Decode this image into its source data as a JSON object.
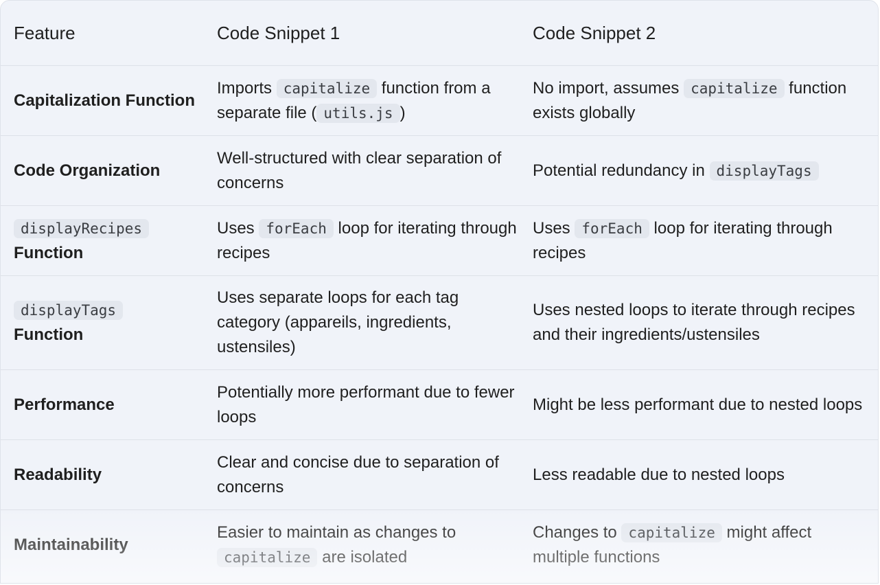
{
  "table": {
    "headers": [
      "Feature",
      "Code Snippet 1",
      "Code Snippet 2"
    ],
    "rows": [
      {
        "feature": {
          "name": "Capitalization Function"
        },
        "snippet1": {
          "t1": "Imports ",
          "c1": "capitalize",
          "t2": " function from a separate file (",
          "c2": "utils.js",
          "t3": ")"
        },
        "snippet2": {
          "t1": "No import, assumes ",
          "c1": "capitalize",
          "t2": " function exists globally"
        }
      },
      {
        "feature": {
          "name": "Code Organization"
        },
        "snippet1": {
          "t1": "Well-structured with clear separation of concerns"
        },
        "snippet2": {
          "t1": "Potential redundancy in ",
          "c1": "displayTags"
        }
      },
      {
        "feature": {
          "code": "displayRecipes",
          "name": "Function"
        },
        "snippet1": {
          "t1": "Uses ",
          "c1": "forEach",
          "t2": " loop for iterating through recipes"
        },
        "snippet2": {
          "t1": "Uses ",
          "c1": "forEach",
          "t2": " loop for iterating through recipes"
        }
      },
      {
        "feature": {
          "code": "displayTags",
          "name": "Function"
        },
        "snippet1": {
          "t1": "Uses separate loops for each tag category (appareils, ingredients, ustensiles)"
        },
        "snippet2": {
          "t1": "Uses nested loops to iterate through recipes and their ingredients/ustensiles"
        }
      },
      {
        "feature": {
          "name": "Performance"
        },
        "snippet1": {
          "t1": "Potentially more performant due to fewer loops"
        },
        "snippet2": {
          "t1": "Might be less performant due to nested loops"
        }
      },
      {
        "feature": {
          "name": "Readability"
        },
        "snippet1": {
          "t1": "Clear and concise due to separation of concerns"
        },
        "snippet2": {
          "t1": "Less readable due to nested loops"
        }
      },
      {
        "feature": {
          "name": "Maintainability"
        },
        "snippet1": {
          "t1": "Easier to maintain as changes to ",
          "c1": "capitalize",
          "t2": " are isolated"
        },
        "snippet2": {
          "t1": "Changes to ",
          "c1": "capitalize",
          "t2": " might affect multiple functions"
        }
      }
    ]
  }
}
